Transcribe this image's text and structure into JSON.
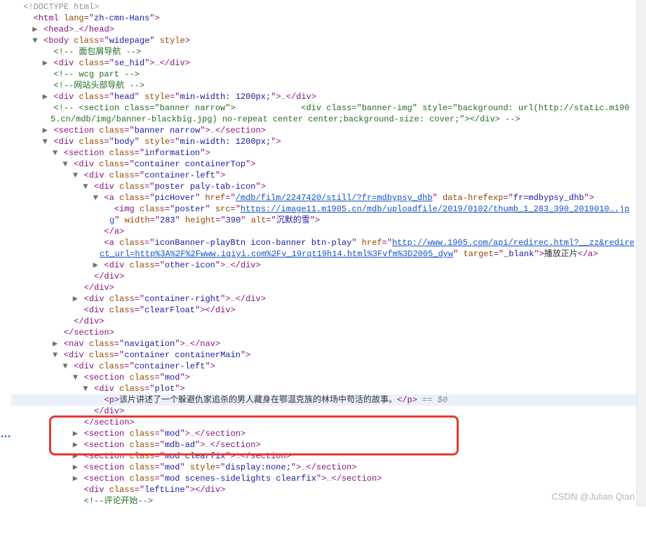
{
  "watermark": "CSDN @Julian Qian",
  "highlight_marker": " == $0",
  "lines": [
    {
      "indent": 0,
      "toggle": "",
      "segs": [
        [
          "t-gray",
          "<!DOCTYPE html>"
        ]
      ]
    },
    {
      "indent": 1,
      "toggle": "",
      "segs": [
        [
          "t-tag",
          "<html "
        ],
        [
          "t-attr",
          "lang"
        ],
        [
          "t-tag",
          "=\""
        ],
        [
          "t-str",
          "zh-cmn-Hans"
        ],
        [
          "t-tag",
          "\">"
        ]
      ]
    },
    {
      "indent": 2,
      "toggle": "▶",
      "segs": [
        [
          "t-tag",
          "<head>"
        ],
        [
          "t-gray",
          "…"
        ],
        [
          "t-tag",
          "</head>"
        ]
      ]
    },
    {
      "indent": 2,
      "toggle": "▼",
      "segs": [
        [
          "t-tag",
          "<body "
        ],
        [
          "t-attr",
          "class"
        ],
        [
          "t-tag",
          "=\""
        ],
        [
          "t-str",
          "widepage"
        ],
        [
          "t-tag",
          "\" "
        ],
        [
          "t-attr",
          "style"
        ],
        [
          "t-tag",
          ">"
        ]
      ]
    },
    {
      "indent": 3,
      "toggle": "",
      "segs": [
        [
          "t-comment",
          "<!-- 面包屑导航 -->"
        ]
      ]
    },
    {
      "indent": 3,
      "toggle": "▶",
      "segs": [
        [
          "t-tag",
          "<div "
        ],
        [
          "t-attr",
          "class"
        ],
        [
          "t-tag",
          "=\""
        ],
        [
          "t-str",
          "se_hid"
        ],
        [
          "t-tag",
          "\">"
        ],
        [
          "t-gray",
          "…"
        ],
        [
          "t-tag",
          "</div>"
        ]
      ]
    },
    {
      "indent": 3,
      "toggle": "",
      "segs": [
        [
          "t-comment",
          "<!-- wcg part -->"
        ]
      ]
    },
    {
      "indent": 3,
      "toggle": "",
      "segs": [
        [
          "t-comment",
          "<!--网站头部导航 -->"
        ]
      ]
    },
    {
      "indent": 3,
      "toggle": "▶",
      "segs": [
        [
          "t-tag",
          "<div "
        ],
        [
          "t-attr",
          "class"
        ],
        [
          "t-tag",
          "=\""
        ],
        [
          "t-str",
          "head"
        ],
        [
          "t-tag",
          "\" "
        ],
        [
          "t-attr",
          "style"
        ],
        [
          "t-tag",
          "=\""
        ],
        [
          "t-str",
          "min-width: 1200px;"
        ],
        [
          "t-tag",
          "\">"
        ],
        [
          "t-gray",
          "…"
        ],
        [
          "t-tag",
          "</div>"
        ]
      ]
    },
    {
      "indent": 3,
      "toggle": "",
      "segs": [
        [
          "t-comment",
          "<!-- <section class=\"banner narrow\">             <div class=\"banner-img\" style=\"background: url(http://static.m1905.cn/mdb/img/banner-blackbig.jpg) no-repeat center center;background-size: cover;\"></div> -->"
        ]
      ],
      "wrap": true
    },
    {
      "indent": 3,
      "toggle": "▶",
      "segs": [
        [
          "t-tag",
          "<section "
        ],
        [
          "t-attr",
          "class"
        ],
        [
          "t-tag",
          "=\""
        ],
        [
          "t-str",
          "banner narrow"
        ],
        [
          "t-tag",
          "\">"
        ],
        [
          "t-gray",
          "…"
        ],
        [
          "t-tag",
          "</section>"
        ]
      ]
    },
    {
      "indent": 3,
      "toggle": "▼",
      "segs": [
        [
          "t-tag",
          "<div "
        ],
        [
          "t-attr",
          "class"
        ],
        [
          "t-tag",
          "=\""
        ],
        [
          "t-str",
          "body"
        ],
        [
          "t-tag",
          "\" "
        ],
        [
          "t-attr",
          "style"
        ],
        [
          "t-tag",
          "=\""
        ],
        [
          "t-str",
          "min-width: 1200px;"
        ],
        [
          "t-tag",
          "\">"
        ]
      ]
    },
    {
      "indent": 4,
      "toggle": "▼",
      "segs": [
        [
          "t-tag",
          "<section "
        ],
        [
          "t-attr",
          "class"
        ],
        [
          "t-tag",
          "=\""
        ],
        [
          "t-str",
          "information"
        ],
        [
          "t-tag",
          "\">"
        ]
      ]
    },
    {
      "indent": 5,
      "toggle": "▼",
      "segs": [
        [
          "t-tag",
          "<div "
        ],
        [
          "t-attr",
          "class"
        ],
        [
          "t-tag",
          "=\""
        ],
        [
          "t-str",
          "container containerTop"
        ],
        [
          "t-tag",
          "\">"
        ]
      ]
    },
    {
      "indent": 6,
      "toggle": "▼",
      "segs": [
        [
          "t-tag",
          "<div "
        ],
        [
          "t-attr",
          "class"
        ],
        [
          "t-tag",
          "=\""
        ],
        [
          "t-str",
          "container-left"
        ],
        [
          "t-tag",
          "\">"
        ]
      ]
    },
    {
      "indent": 7,
      "toggle": "▼",
      "segs": [
        [
          "t-tag",
          "<div "
        ],
        [
          "t-attr",
          "class"
        ],
        [
          "t-tag",
          "=\""
        ],
        [
          "t-str",
          "poster paly-tab-icon"
        ],
        [
          "t-tag",
          "\">"
        ]
      ]
    },
    {
      "indent": 8,
      "toggle": "▼",
      "segs": [
        [
          "t-tag",
          "<a "
        ],
        [
          "t-attr",
          "class"
        ],
        [
          "t-tag",
          "=\""
        ],
        [
          "t-str",
          "picHover"
        ],
        [
          "t-tag",
          "\" "
        ],
        [
          "t-attr",
          "href"
        ],
        [
          "t-tag",
          "=\""
        ],
        [
          "t-link",
          "/mdb/film/2247420/still/?fr=mdbypsy_dhb"
        ],
        [
          "t-tag",
          "\" "
        ],
        [
          "t-attr",
          "data-hrefexp"
        ],
        [
          "t-tag",
          "=\""
        ],
        [
          "t-str",
          "fr=mdbypsy_dhb"
        ],
        [
          "t-tag",
          "\">"
        ]
      ]
    },
    {
      "indent": 9,
      "toggle": "",
      "segs": [
        [
          "t-tag",
          "<img "
        ],
        [
          "t-attr",
          "class"
        ],
        [
          "t-tag",
          "=\""
        ],
        [
          "t-str",
          "poster"
        ],
        [
          "t-tag",
          "\" "
        ],
        [
          "t-attr",
          "src"
        ],
        [
          "t-tag",
          "=\""
        ],
        [
          "t-link",
          "https://image11.m1905.cn/mdb/uploadfile/2019/0102/thumb_1_283_390_2019010….jpg"
        ],
        [
          "t-tag",
          "\" "
        ],
        [
          "t-attr",
          "width"
        ],
        [
          "t-tag",
          "=\""
        ],
        [
          "t-str",
          "283"
        ],
        [
          "t-tag",
          "\" "
        ],
        [
          "t-attr",
          "height"
        ],
        [
          "t-tag",
          "=\""
        ],
        [
          "t-str",
          "390"
        ],
        [
          "t-tag",
          "\" "
        ],
        [
          "t-attr",
          "alt"
        ],
        [
          "t-tag",
          "=\""
        ],
        [
          "t-str",
          "沉默的雪"
        ],
        [
          "t-tag",
          "\">"
        ]
      ],
      "wrap": true
    },
    {
      "indent": 8,
      "toggle": "",
      "segs": [
        [
          "t-tag",
          "</a>"
        ]
      ]
    },
    {
      "indent": 8,
      "toggle": "",
      "segs": [
        [
          "t-tag",
          "<a "
        ],
        [
          "t-attr",
          "class"
        ],
        [
          "t-tag",
          "=\""
        ],
        [
          "t-str",
          "iconBanner-playBtn icon-banner btn-play"
        ],
        [
          "t-tag",
          "\" "
        ],
        [
          "t-attr",
          "href"
        ],
        [
          "t-tag",
          "=\""
        ],
        [
          "t-link",
          "http://www.1905.com/api/redirec.html?__zz&redirect_url=http%3A%2F%2Fwww.iqiyi.com%2Fv_19rqt19h14.html%3Fvfm%3D2005_dyw"
        ],
        [
          "t-tag",
          "\" "
        ],
        [
          "t-attr",
          "target"
        ],
        [
          "t-tag",
          "=\""
        ],
        [
          "t-str",
          "_blank"
        ],
        [
          "t-tag",
          "\">"
        ],
        [
          "",
          "播放正片"
        ],
        [
          "t-tag",
          "</a>"
        ]
      ],
      "wrap": true
    },
    {
      "indent": 8,
      "toggle": "▶",
      "segs": [
        [
          "t-tag",
          "<div "
        ],
        [
          "t-attr",
          "class"
        ],
        [
          "t-tag",
          "=\""
        ],
        [
          "t-str",
          "other-icon"
        ],
        [
          "t-tag",
          "\">"
        ],
        [
          "t-gray",
          "…"
        ],
        [
          "t-tag",
          "</div>"
        ]
      ]
    },
    {
      "indent": 7,
      "toggle": "",
      "segs": [
        [
          "t-tag",
          "</div>"
        ]
      ]
    },
    {
      "indent": 6,
      "toggle": "",
      "segs": [
        [
          "t-tag",
          "</div>"
        ]
      ]
    },
    {
      "indent": 6,
      "toggle": "▶",
      "segs": [
        [
          "t-tag",
          "<div "
        ],
        [
          "t-attr",
          "class"
        ],
        [
          "t-tag",
          "=\""
        ],
        [
          "t-str",
          "container-right"
        ],
        [
          "t-tag",
          "\">"
        ],
        [
          "t-gray",
          "…"
        ],
        [
          "t-tag",
          "</div>"
        ]
      ]
    },
    {
      "indent": 6,
      "toggle": "",
      "segs": [
        [
          "t-tag",
          "<div "
        ],
        [
          "t-attr",
          "class"
        ],
        [
          "t-tag",
          "=\""
        ],
        [
          "t-str",
          "clearFloat"
        ],
        [
          "t-tag",
          "\"></div>"
        ]
      ]
    },
    {
      "indent": 5,
      "toggle": "",
      "segs": [
        [
          "t-tag",
          "</div>"
        ]
      ]
    },
    {
      "indent": 4,
      "toggle": "",
      "segs": [
        [
          "t-tag",
          "</section>"
        ]
      ]
    },
    {
      "indent": 4,
      "toggle": "▶",
      "segs": [
        [
          "t-tag",
          "<nav "
        ],
        [
          "t-attr",
          "class"
        ],
        [
          "t-tag",
          "=\""
        ],
        [
          "t-str",
          "navigation"
        ],
        [
          "t-tag",
          "\">"
        ],
        [
          "t-gray",
          "…"
        ],
        [
          "t-tag",
          "</nav>"
        ]
      ]
    },
    {
      "indent": 4,
      "toggle": "▼",
      "segs": [
        [
          "t-tag",
          "<div "
        ],
        [
          "t-attr",
          "class"
        ],
        [
          "t-tag",
          "=\""
        ],
        [
          "t-str",
          "container containerMain"
        ],
        [
          "t-tag",
          "\">"
        ]
      ]
    },
    {
      "indent": 5,
      "toggle": "▼",
      "segs": [
        [
          "t-tag",
          "<div "
        ],
        [
          "t-attr",
          "class"
        ],
        [
          "t-tag",
          "=\""
        ],
        [
          "t-str",
          "container-left"
        ],
        [
          "t-tag",
          "\">"
        ]
      ]
    },
    {
      "indent": 6,
      "toggle": "▼",
      "segs": [
        [
          "t-tag",
          "<section "
        ],
        [
          "t-attr",
          "class"
        ],
        [
          "t-tag",
          "=\""
        ],
        [
          "t-str",
          "mod"
        ],
        [
          "t-tag",
          "\">"
        ]
      ]
    },
    {
      "indent": 7,
      "toggle": "▼",
      "segs": [
        [
          "t-tag",
          "<div "
        ],
        [
          "t-attr",
          "class"
        ],
        [
          "t-tag",
          "=\""
        ],
        [
          "t-str",
          "plot"
        ],
        [
          "t-tag",
          "\">"
        ]
      ]
    },
    {
      "indent": 8,
      "toggle": "",
      "hl": true,
      "segs": [
        [
          "t-tag",
          "<p>"
        ],
        [
          "",
          "该片讲述了一个躲避仇家追杀的男人藏身在鄂温克族的林场中苟活的故事。"
        ],
        [
          "t-tag",
          "</p>"
        ]
      ],
      "marker": true
    },
    {
      "indent": 7,
      "toggle": "",
      "segs": [
        [
          "t-tag",
          "</div>"
        ]
      ]
    },
    {
      "indent": 6,
      "toggle": "",
      "segs": [
        [
          "t-tag",
          "</section>"
        ]
      ]
    },
    {
      "indent": 6,
      "toggle": "▶",
      "segs": [
        [
          "t-tag",
          "<section "
        ],
        [
          "t-attr",
          "class"
        ],
        [
          "t-tag",
          "=\""
        ],
        [
          "t-str",
          "mod"
        ],
        [
          "t-tag",
          "\">"
        ],
        [
          "t-gray",
          "…"
        ],
        [
          "t-tag",
          "</section>"
        ]
      ]
    },
    {
      "indent": 6,
      "toggle": "▶",
      "segs": [
        [
          "t-tag",
          "<section "
        ],
        [
          "t-attr",
          "class"
        ],
        [
          "t-tag",
          "=\""
        ],
        [
          "t-str",
          "mdb-ad"
        ],
        [
          "t-tag",
          "\">"
        ],
        [
          "t-gray",
          "…"
        ],
        [
          "t-tag",
          "</section>"
        ]
      ]
    },
    {
      "indent": 6,
      "toggle": "▶",
      "segs": [
        [
          "t-tag",
          "<section "
        ],
        [
          "t-attr",
          "class"
        ],
        [
          "t-tag",
          "=\""
        ],
        [
          "t-str",
          "mod clearfix"
        ],
        [
          "t-tag",
          "\">"
        ],
        [
          "t-gray",
          "…"
        ],
        [
          "t-tag",
          "</section>"
        ]
      ]
    },
    {
      "indent": 6,
      "toggle": "▶",
      "segs": [
        [
          "t-tag",
          "<section "
        ],
        [
          "t-attr",
          "class"
        ],
        [
          "t-tag",
          "=\""
        ],
        [
          "t-str",
          "mod"
        ],
        [
          "t-tag",
          "\" "
        ],
        [
          "t-attr",
          "style"
        ],
        [
          "t-tag",
          "=\""
        ],
        [
          "t-str",
          "display:none;"
        ],
        [
          "t-tag",
          "\">"
        ],
        [
          "t-gray",
          "…"
        ],
        [
          "t-tag",
          "</section>"
        ]
      ]
    },
    {
      "indent": 6,
      "toggle": "▶",
      "segs": [
        [
          "t-tag",
          "<section "
        ],
        [
          "t-attr",
          "class"
        ],
        [
          "t-tag",
          "=\""
        ],
        [
          "t-str",
          "mod scenes-sidelights clearfix"
        ],
        [
          "t-tag",
          "\">"
        ],
        [
          "t-gray",
          "…"
        ],
        [
          "t-tag",
          "</section>"
        ]
      ]
    },
    {
      "indent": 6,
      "toggle": "",
      "segs": [
        [
          "t-tag",
          "<div "
        ],
        [
          "t-attr",
          "class"
        ],
        [
          "t-tag",
          "=\""
        ],
        [
          "t-str",
          "leftLine"
        ],
        [
          "t-tag",
          "\"></div>"
        ]
      ]
    },
    {
      "indent": 6,
      "toggle": "",
      "segs": [
        [
          "t-comment",
          "<!--评论开始-->"
        ]
      ]
    }
  ]
}
